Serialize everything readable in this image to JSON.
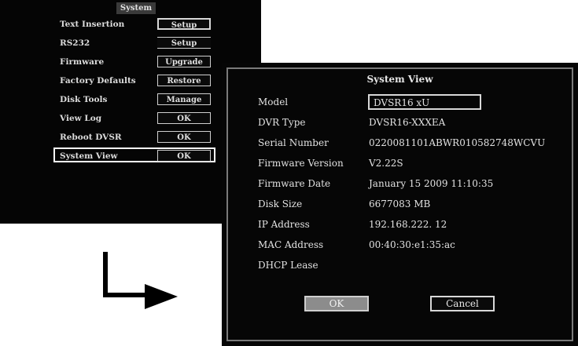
{
  "system_menu": {
    "title": "System",
    "items": [
      {
        "label": "Text Insertion",
        "button": "Setup"
      },
      {
        "label": "RS232",
        "button": "Setup"
      },
      {
        "label": "Firmware",
        "button": "Upgrade"
      },
      {
        "label": "Factory Defaults",
        "button": "Restore"
      },
      {
        "label": "Disk Tools",
        "button": "Manage"
      },
      {
        "label": "View Log",
        "button": "OK"
      },
      {
        "label": "Reboot DVSR",
        "button": "OK"
      },
      {
        "label": "System View",
        "button": "OK"
      }
    ],
    "selected_item": "System View"
  },
  "system_view": {
    "title": "System View",
    "fields": [
      {
        "label": "Model",
        "value": "DVSR16 xU"
      },
      {
        "label": "DVR Type",
        "value": "DVSR16-XXXEA"
      },
      {
        "label": "Serial Number",
        "value": "0220081101ABWR010582748WCVU"
      },
      {
        "label": "Firmware Version",
        "value": "V2.22S"
      },
      {
        "label": "Firmware Date",
        "value": "January 15 2009 11:10:35"
      },
      {
        "label": "Disk Size",
        "value": "6677083 MB"
      },
      {
        "label": "IP Address",
        "value": "192.168.222. 12"
      },
      {
        "label": "MAC Address",
        "value": "00:40:30:e1:35:ac"
      },
      {
        "label": "DHCP Lease",
        "value": ""
      }
    ],
    "ok_label": "OK",
    "cancel_label": "Cancel"
  },
  "icons": {
    "arrow": "arrow-down-right-icon"
  },
  "colors": {
    "window_bg": "#050505",
    "text": "#e2e2e2",
    "ok_button_bg": "#8c8c8c"
  }
}
